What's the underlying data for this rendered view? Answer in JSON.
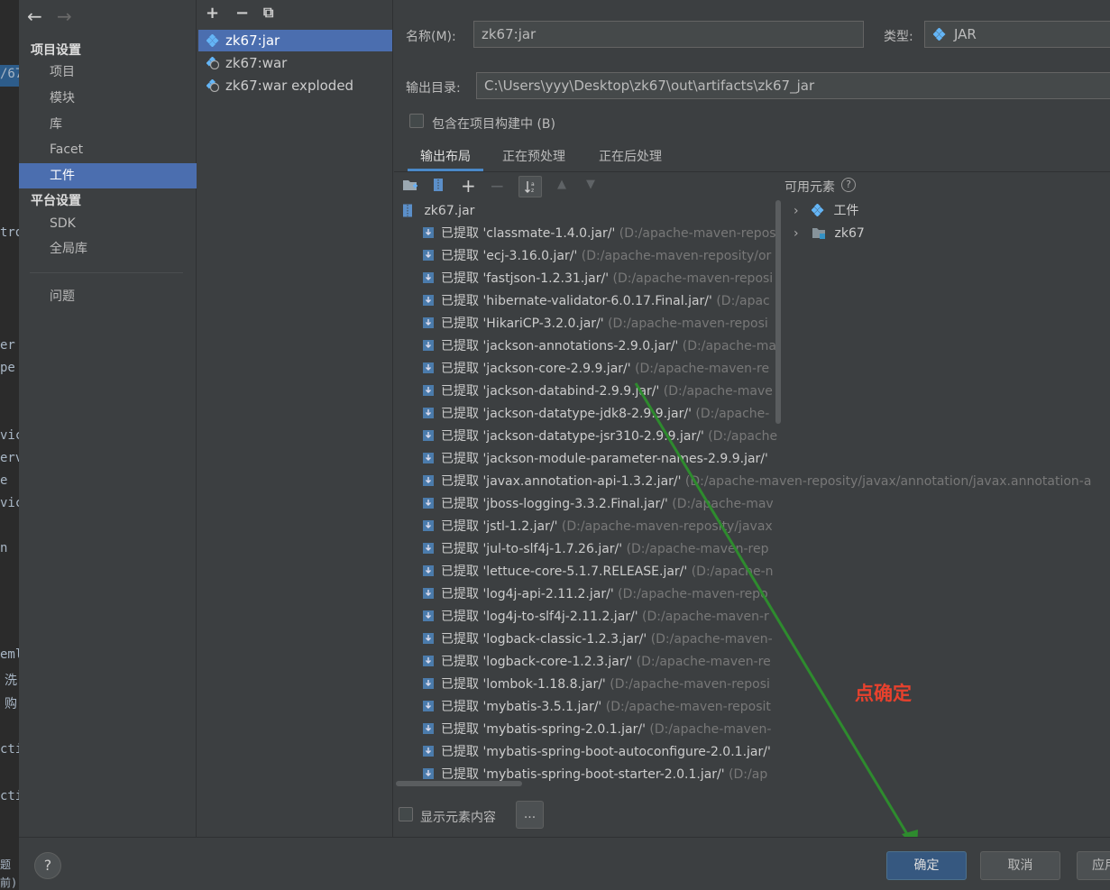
{
  "edge": {
    "chars": [
      "/67",
      "tro",
      "er",
      "pe",
      "vice",
      "erv",
      "e",
      "vice",
      "n",
      "eml",
      "洗",
      "购",
      "cti",
      "cti",
      "题",
      "前)"
    ]
  },
  "sidebar": {
    "back": "←",
    "forward": "→",
    "project_settings_title": "项目设置",
    "project_items": [
      "项目",
      "模块",
      "库",
      "Facet",
      "工件"
    ],
    "platform_settings_title": "平台设置",
    "platform_items": [
      "SDK",
      "全局库"
    ],
    "problems": "问题"
  },
  "artifacts": {
    "toolbar": {
      "add": "+",
      "remove": "−",
      "copy": "⧉"
    },
    "items": [
      "zk67:jar",
      "zk67:war",
      "zk67:war exploded"
    ]
  },
  "main": {
    "name_label": "名称(M):",
    "name_value": "zk67:jar",
    "type_label": "类型:",
    "type_value": "JAR",
    "output_label": "输出目录:",
    "output_value": "C:\\Users\\yyy\\Desktop\\zk67\\out\\artifacts\\zk67_jar",
    "include_build_label": "包含在项目构建中 (B)",
    "tabs": [
      "输出布局",
      "正在预处理",
      "正在后处理"
    ],
    "available_label": "可用元素",
    "available_help": "?",
    "available_items": [
      "工件",
      "zk67"
    ],
    "root_item": "zk67.jar",
    "extracted_prefix": "已提取",
    "entries": [
      {
        "name": "'classmate-1.4.0.jar/'",
        "path": "(D:/apache-maven-reposi"
      },
      {
        "name": "'ecj-3.16.0.jar/'",
        "path": "(D:/apache-maven-reposity/or"
      },
      {
        "name": "'fastjson-1.2.31.jar/'",
        "path": "(D:/apache-maven-reposi"
      },
      {
        "name": "'hibernate-validator-6.0.17.Final.jar/'",
        "path": "(D:/apac"
      },
      {
        "name": "'HikariCP-3.2.0.jar/'",
        "path": "(D:/apache-maven-reposi"
      },
      {
        "name": "'jackson-annotations-2.9.0.jar/'",
        "path": "(D:/apache-ma"
      },
      {
        "name": "'jackson-core-2.9.9.jar/'",
        "path": "(D:/apache-maven-re"
      },
      {
        "name": "'jackson-databind-2.9.9.jar/'",
        "path": "(D:/apache-mave"
      },
      {
        "name": "'jackson-datatype-jdk8-2.9.9.jar/'",
        "path": "(D:/apache-"
      },
      {
        "name": "'jackson-datatype-jsr310-2.9.9.jar/'",
        "path": "(D:/apache"
      },
      {
        "name": "'jackson-module-parameter-names-2.9.9.jar/'",
        "path": ""
      },
      {
        "name": "'javax.annotation-api-1.3.2.jar/'",
        "path": "(D:/apache-maven-reposity/javax/annotation/javax.annotation-a"
      },
      {
        "name": "'jboss-logging-3.3.2.Final.jar/'",
        "path": "(D:/apache-mav"
      },
      {
        "name": "'jstl-1.2.jar/'",
        "path": "(D:/apache-maven-reposity/javax"
      },
      {
        "name": "'jul-to-slf4j-1.7.26.jar/'",
        "path": "(D:/apache-maven-rep"
      },
      {
        "name": "'lettuce-core-5.1.7.RELEASE.jar/'",
        "path": "(D:/apache-n"
      },
      {
        "name": "'log4j-api-2.11.2.jar/'",
        "path": "(D:/apache-maven-repo"
      },
      {
        "name": "'log4j-to-slf4j-2.11.2.jar/'",
        "path": "(D:/apache-maven-r"
      },
      {
        "name": "'logback-classic-1.2.3.jar/'",
        "path": "(D:/apache-maven-"
      },
      {
        "name": "'logback-core-1.2.3.jar/'",
        "path": "(D:/apache-maven-re"
      },
      {
        "name": "'lombok-1.18.8.jar/'",
        "path": "(D:/apache-maven-reposi"
      },
      {
        "name": "'mybatis-3.5.1.jar/'",
        "path": "(D:/apache-maven-reposit"
      },
      {
        "name": "'mybatis-spring-2.0.1.jar/'",
        "path": "(D:/apache-maven-"
      },
      {
        "name": "'mybatis-spring-boot-autoconfigure-2.0.1.jar/'",
        "path": ""
      },
      {
        "name": "'mybatis-spring-boot-starter-2.0.1.jar/'",
        "path": "(D:/ap"
      }
    ],
    "show_content_label": "显示元素内容",
    "ellipsis": "..."
  },
  "annotation": "点确定",
  "buttons": {
    "help": "?",
    "ok": "确定",
    "cancel": "取消",
    "apply": "应用"
  },
  "colors": {
    "accent": "#4b6eaf",
    "primary_button": "#365880",
    "annotation": "#e8412d",
    "arrow": "#2e8b2e"
  }
}
